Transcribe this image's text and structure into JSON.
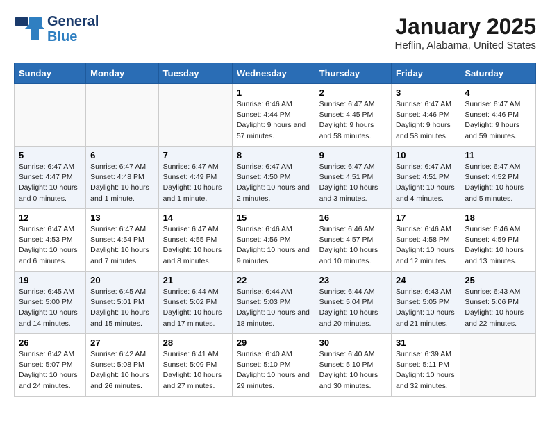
{
  "header": {
    "logo_line1": "General",
    "logo_line2": "Blue",
    "title": "January 2025",
    "subtitle": "Heflin, Alabama, United States"
  },
  "days_of_week": [
    "Sunday",
    "Monday",
    "Tuesday",
    "Wednesday",
    "Thursday",
    "Friday",
    "Saturday"
  ],
  "weeks": [
    [
      {
        "num": "",
        "info": ""
      },
      {
        "num": "",
        "info": ""
      },
      {
        "num": "",
        "info": ""
      },
      {
        "num": "1",
        "info": "Sunrise: 6:46 AM\nSunset: 4:44 PM\nDaylight: 9 hours and 57 minutes."
      },
      {
        "num": "2",
        "info": "Sunrise: 6:47 AM\nSunset: 4:45 PM\nDaylight: 9 hours and 58 minutes."
      },
      {
        "num": "3",
        "info": "Sunrise: 6:47 AM\nSunset: 4:46 PM\nDaylight: 9 hours and 58 minutes."
      },
      {
        "num": "4",
        "info": "Sunrise: 6:47 AM\nSunset: 4:46 PM\nDaylight: 9 hours and 59 minutes."
      }
    ],
    [
      {
        "num": "5",
        "info": "Sunrise: 6:47 AM\nSunset: 4:47 PM\nDaylight: 10 hours and 0 minutes."
      },
      {
        "num": "6",
        "info": "Sunrise: 6:47 AM\nSunset: 4:48 PM\nDaylight: 10 hours and 1 minute."
      },
      {
        "num": "7",
        "info": "Sunrise: 6:47 AM\nSunset: 4:49 PM\nDaylight: 10 hours and 1 minute."
      },
      {
        "num": "8",
        "info": "Sunrise: 6:47 AM\nSunset: 4:50 PM\nDaylight: 10 hours and 2 minutes."
      },
      {
        "num": "9",
        "info": "Sunrise: 6:47 AM\nSunset: 4:51 PM\nDaylight: 10 hours and 3 minutes."
      },
      {
        "num": "10",
        "info": "Sunrise: 6:47 AM\nSunset: 4:51 PM\nDaylight: 10 hours and 4 minutes."
      },
      {
        "num": "11",
        "info": "Sunrise: 6:47 AM\nSunset: 4:52 PM\nDaylight: 10 hours and 5 minutes."
      }
    ],
    [
      {
        "num": "12",
        "info": "Sunrise: 6:47 AM\nSunset: 4:53 PM\nDaylight: 10 hours and 6 minutes."
      },
      {
        "num": "13",
        "info": "Sunrise: 6:47 AM\nSunset: 4:54 PM\nDaylight: 10 hours and 7 minutes."
      },
      {
        "num": "14",
        "info": "Sunrise: 6:47 AM\nSunset: 4:55 PM\nDaylight: 10 hours and 8 minutes."
      },
      {
        "num": "15",
        "info": "Sunrise: 6:46 AM\nSunset: 4:56 PM\nDaylight: 10 hours and 9 minutes."
      },
      {
        "num": "16",
        "info": "Sunrise: 6:46 AM\nSunset: 4:57 PM\nDaylight: 10 hours and 10 minutes."
      },
      {
        "num": "17",
        "info": "Sunrise: 6:46 AM\nSunset: 4:58 PM\nDaylight: 10 hours and 12 minutes."
      },
      {
        "num": "18",
        "info": "Sunrise: 6:46 AM\nSunset: 4:59 PM\nDaylight: 10 hours and 13 minutes."
      }
    ],
    [
      {
        "num": "19",
        "info": "Sunrise: 6:45 AM\nSunset: 5:00 PM\nDaylight: 10 hours and 14 minutes."
      },
      {
        "num": "20",
        "info": "Sunrise: 6:45 AM\nSunset: 5:01 PM\nDaylight: 10 hours and 15 minutes."
      },
      {
        "num": "21",
        "info": "Sunrise: 6:44 AM\nSunset: 5:02 PM\nDaylight: 10 hours and 17 minutes."
      },
      {
        "num": "22",
        "info": "Sunrise: 6:44 AM\nSunset: 5:03 PM\nDaylight: 10 hours and 18 minutes."
      },
      {
        "num": "23",
        "info": "Sunrise: 6:44 AM\nSunset: 5:04 PM\nDaylight: 10 hours and 20 minutes."
      },
      {
        "num": "24",
        "info": "Sunrise: 6:43 AM\nSunset: 5:05 PM\nDaylight: 10 hours and 21 minutes."
      },
      {
        "num": "25",
        "info": "Sunrise: 6:43 AM\nSunset: 5:06 PM\nDaylight: 10 hours and 22 minutes."
      }
    ],
    [
      {
        "num": "26",
        "info": "Sunrise: 6:42 AM\nSunset: 5:07 PM\nDaylight: 10 hours and 24 minutes."
      },
      {
        "num": "27",
        "info": "Sunrise: 6:42 AM\nSunset: 5:08 PM\nDaylight: 10 hours and 26 minutes."
      },
      {
        "num": "28",
        "info": "Sunrise: 6:41 AM\nSunset: 5:09 PM\nDaylight: 10 hours and 27 minutes."
      },
      {
        "num": "29",
        "info": "Sunrise: 6:40 AM\nSunset: 5:10 PM\nDaylight: 10 hours and 29 minutes."
      },
      {
        "num": "30",
        "info": "Sunrise: 6:40 AM\nSunset: 5:10 PM\nDaylight: 10 hours and 30 minutes."
      },
      {
        "num": "31",
        "info": "Sunrise: 6:39 AM\nSunset: 5:11 PM\nDaylight: 10 hours and 32 minutes."
      },
      {
        "num": "",
        "info": ""
      }
    ]
  ]
}
